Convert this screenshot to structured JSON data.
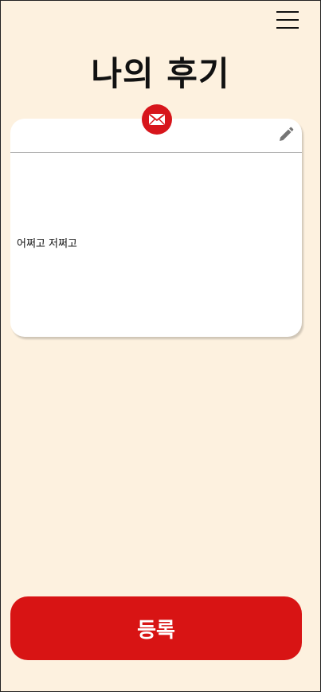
{
  "header": {
    "menu_icon": "hamburger-menu-icon",
    "title": "나의 후기"
  },
  "review_card": {
    "badge_icon": "mail-icon",
    "title_value": "",
    "edit_icon": "pencil-icon",
    "body_text": "어쩌고 저쩌고"
  },
  "actions": {
    "submit_label": "등록"
  },
  "colors": {
    "background": "#fdf1df",
    "accent": "#d81414",
    "card": "#ffffff"
  }
}
